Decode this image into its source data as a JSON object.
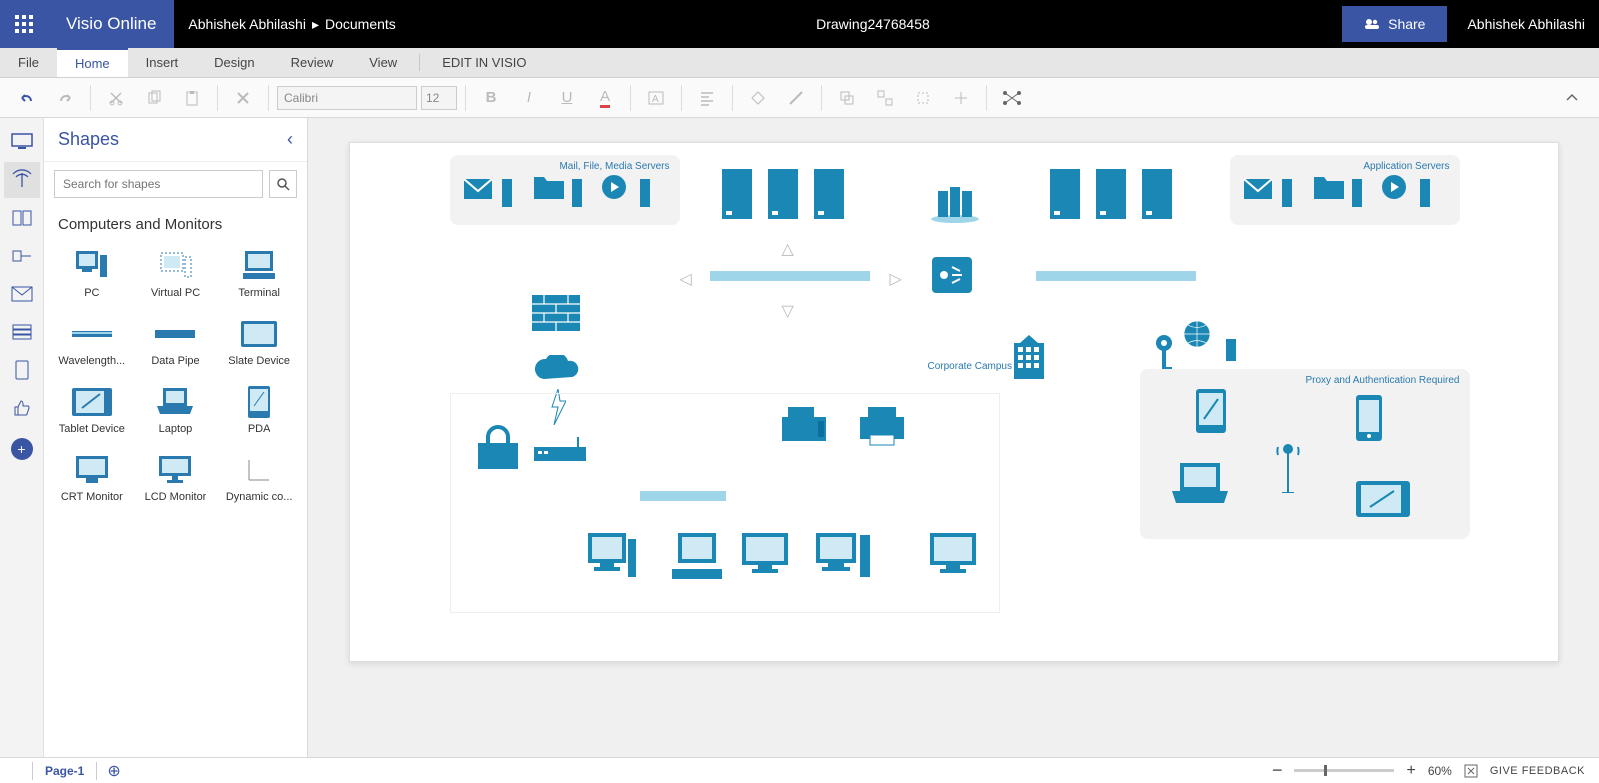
{
  "header": {
    "brand": "Visio Online",
    "breadcrumb_user": "Abhishek Abhilashi",
    "breadcrumb_sep": "▸",
    "breadcrumb_loc": "Documents",
    "doc_title": "Drawing24768458",
    "share_label": "Share",
    "user": "Abhishek Abhilashi"
  },
  "menu": {
    "file": "File",
    "home": "Home",
    "insert": "Insert",
    "design": "Design",
    "review": "Review",
    "view": "View",
    "edit_in_visio": "EDIT IN VISIO"
  },
  "ribbon": {
    "font": "Calibri",
    "size": "12"
  },
  "shapes": {
    "title": "Shapes",
    "search_placeholder": "Search for shapes",
    "category": "Computers and Monitors",
    "items": [
      {
        "label": "PC"
      },
      {
        "label": "Virtual PC"
      },
      {
        "label": "Terminal"
      },
      {
        "label": "Wavelength..."
      },
      {
        "label": "Data Pipe"
      },
      {
        "label": "Slate Device"
      },
      {
        "label": "Tablet Device"
      },
      {
        "label": "Laptop"
      },
      {
        "label": "PDA"
      },
      {
        "label": "CRT Monitor"
      },
      {
        "label": "LCD Monitor"
      },
      {
        "label": "Dynamic co..."
      }
    ]
  },
  "diagram": {
    "box_mail": "Mail, File, Media Servers",
    "box_app": "Application Servers",
    "box_proxy": "Proxy and Authentication Required",
    "label_campus": "Corporate Campus"
  },
  "footer": {
    "page_tab": "Page-1",
    "zoom": "60%",
    "feedback": "GIVE FEEDBACK"
  }
}
